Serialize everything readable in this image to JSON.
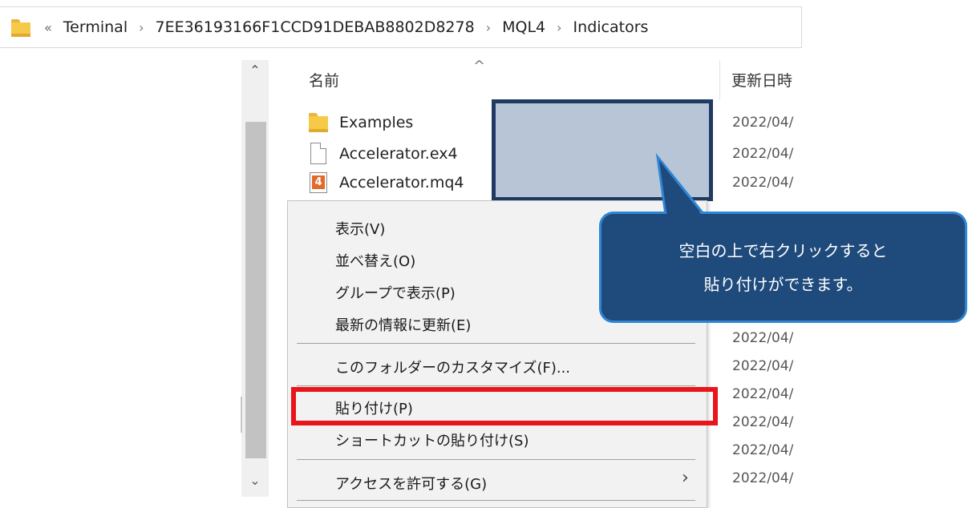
{
  "address_bar": {
    "back_chevron": "«",
    "separator": "›",
    "crumbs": [
      "Terminal",
      "7EE36193166F1CCD91DEBAB8802D8278",
      "MQL4",
      "Indicators"
    ]
  },
  "columns": {
    "name": "名前",
    "date": "更新日時"
  },
  "files": [
    {
      "name": "Examples",
      "icon": "folder-icon",
      "date": "2022/04/"
    },
    {
      "name": "Accelerator.ex4",
      "icon": "file-icon",
      "date": "2022/04/"
    },
    {
      "name": "Accelerator.mq4",
      "icon": "mq4-file-icon",
      "date": "2022/04/"
    }
  ],
  "mq4_badge": "4",
  "visible_dates": [
    "2022/04/",
    "2022/04/",
    "2022/04/",
    "2022/04/",
    "2022/04/",
    "2022/04/"
  ],
  "context_menu": {
    "view": "表示(V)",
    "sort_by": "並べ替え(O)",
    "group_by": "グループで表示(P)",
    "refresh": "最新の情報に更新(E)",
    "customize": "このフォルダーのカスタマイズ(F)...",
    "paste": "貼り付け(P)",
    "paste_shortcut": "ショートカットの貼り付け(S)",
    "give_access": "アクセスを許可する(G)"
  },
  "callout": {
    "line1": "空白の上で右クリックすると",
    "line2": "貼り付けができます。"
  },
  "colors": {
    "callout_fill": "#1f4a7c",
    "callout_border": "#2e86d4",
    "highlight_fill": "#b7c5d6",
    "highlight_border": "#1f3a63",
    "paste_outline": "#e8151b",
    "folder": "#f7c948"
  }
}
